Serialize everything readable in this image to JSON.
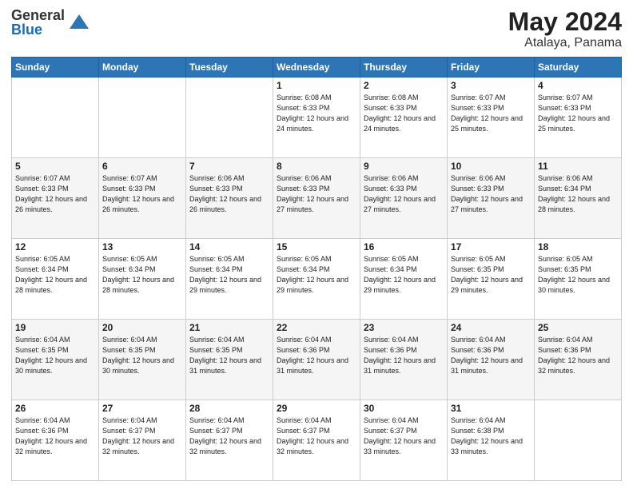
{
  "logo": {
    "general": "General",
    "blue": "Blue"
  },
  "header": {
    "month_year": "May 2024",
    "location": "Atalaya, Panama"
  },
  "weekdays": [
    "Sunday",
    "Monday",
    "Tuesday",
    "Wednesday",
    "Thursday",
    "Friday",
    "Saturday"
  ],
  "weeks": [
    [
      {
        "day": "",
        "sunrise": "",
        "sunset": "",
        "daylight": ""
      },
      {
        "day": "",
        "sunrise": "",
        "sunset": "",
        "daylight": ""
      },
      {
        "day": "",
        "sunrise": "",
        "sunset": "",
        "daylight": ""
      },
      {
        "day": "1",
        "sunrise": "Sunrise: 6:08 AM",
        "sunset": "Sunset: 6:33 PM",
        "daylight": "Daylight: 12 hours and 24 minutes."
      },
      {
        "day": "2",
        "sunrise": "Sunrise: 6:08 AM",
        "sunset": "Sunset: 6:33 PM",
        "daylight": "Daylight: 12 hours and 24 minutes."
      },
      {
        "day": "3",
        "sunrise": "Sunrise: 6:07 AM",
        "sunset": "Sunset: 6:33 PM",
        "daylight": "Daylight: 12 hours and 25 minutes."
      },
      {
        "day": "4",
        "sunrise": "Sunrise: 6:07 AM",
        "sunset": "Sunset: 6:33 PM",
        "daylight": "Daylight: 12 hours and 25 minutes."
      }
    ],
    [
      {
        "day": "5",
        "sunrise": "Sunrise: 6:07 AM",
        "sunset": "Sunset: 6:33 PM",
        "daylight": "Daylight: 12 hours and 26 minutes."
      },
      {
        "day": "6",
        "sunrise": "Sunrise: 6:07 AM",
        "sunset": "Sunset: 6:33 PM",
        "daylight": "Daylight: 12 hours and 26 minutes."
      },
      {
        "day": "7",
        "sunrise": "Sunrise: 6:06 AM",
        "sunset": "Sunset: 6:33 PM",
        "daylight": "Daylight: 12 hours and 26 minutes."
      },
      {
        "day": "8",
        "sunrise": "Sunrise: 6:06 AM",
        "sunset": "Sunset: 6:33 PM",
        "daylight": "Daylight: 12 hours and 27 minutes."
      },
      {
        "day": "9",
        "sunrise": "Sunrise: 6:06 AM",
        "sunset": "Sunset: 6:33 PM",
        "daylight": "Daylight: 12 hours and 27 minutes."
      },
      {
        "day": "10",
        "sunrise": "Sunrise: 6:06 AM",
        "sunset": "Sunset: 6:33 PM",
        "daylight": "Daylight: 12 hours and 27 minutes."
      },
      {
        "day": "11",
        "sunrise": "Sunrise: 6:06 AM",
        "sunset": "Sunset: 6:34 PM",
        "daylight": "Daylight: 12 hours and 28 minutes."
      }
    ],
    [
      {
        "day": "12",
        "sunrise": "Sunrise: 6:05 AM",
        "sunset": "Sunset: 6:34 PM",
        "daylight": "Daylight: 12 hours and 28 minutes."
      },
      {
        "day": "13",
        "sunrise": "Sunrise: 6:05 AM",
        "sunset": "Sunset: 6:34 PM",
        "daylight": "Daylight: 12 hours and 28 minutes."
      },
      {
        "day": "14",
        "sunrise": "Sunrise: 6:05 AM",
        "sunset": "Sunset: 6:34 PM",
        "daylight": "Daylight: 12 hours and 29 minutes."
      },
      {
        "day": "15",
        "sunrise": "Sunrise: 6:05 AM",
        "sunset": "Sunset: 6:34 PM",
        "daylight": "Daylight: 12 hours and 29 minutes."
      },
      {
        "day": "16",
        "sunrise": "Sunrise: 6:05 AM",
        "sunset": "Sunset: 6:34 PM",
        "daylight": "Daylight: 12 hours and 29 minutes."
      },
      {
        "day": "17",
        "sunrise": "Sunrise: 6:05 AM",
        "sunset": "Sunset: 6:35 PM",
        "daylight": "Daylight: 12 hours and 29 minutes."
      },
      {
        "day": "18",
        "sunrise": "Sunrise: 6:05 AM",
        "sunset": "Sunset: 6:35 PM",
        "daylight": "Daylight: 12 hours and 30 minutes."
      }
    ],
    [
      {
        "day": "19",
        "sunrise": "Sunrise: 6:04 AM",
        "sunset": "Sunset: 6:35 PM",
        "daylight": "Daylight: 12 hours and 30 minutes."
      },
      {
        "day": "20",
        "sunrise": "Sunrise: 6:04 AM",
        "sunset": "Sunset: 6:35 PM",
        "daylight": "Daylight: 12 hours and 30 minutes."
      },
      {
        "day": "21",
        "sunrise": "Sunrise: 6:04 AM",
        "sunset": "Sunset: 6:35 PM",
        "daylight": "Daylight: 12 hours and 31 minutes."
      },
      {
        "day": "22",
        "sunrise": "Sunrise: 6:04 AM",
        "sunset": "Sunset: 6:36 PM",
        "daylight": "Daylight: 12 hours and 31 minutes."
      },
      {
        "day": "23",
        "sunrise": "Sunrise: 6:04 AM",
        "sunset": "Sunset: 6:36 PM",
        "daylight": "Daylight: 12 hours and 31 minutes."
      },
      {
        "day": "24",
        "sunrise": "Sunrise: 6:04 AM",
        "sunset": "Sunset: 6:36 PM",
        "daylight": "Daylight: 12 hours and 31 minutes."
      },
      {
        "day": "25",
        "sunrise": "Sunrise: 6:04 AM",
        "sunset": "Sunset: 6:36 PM",
        "daylight": "Daylight: 12 hours and 32 minutes."
      }
    ],
    [
      {
        "day": "26",
        "sunrise": "Sunrise: 6:04 AM",
        "sunset": "Sunset: 6:36 PM",
        "daylight": "Daylight: 12 hours and 32 minutes."
      },
      {
        "day": "27",
        "sunrise": "Sunrise: 6:04 AM",
        "sunset": "Sunset: 6:37 PM",
        "daylight": "Daylight: 12 hours and 32 minutes."
      },
      {
        "day": "28",
        "sunrise": "Sunrise: 6:04 AM",
        "sunset": "Sunset: 6:37 PM",
        "daylight": "Daylight: 12 hours and 32 minutes."
      },
      {
        "day": "29",
        "sunrise": "Sunrise: 6:04 AM",
        "sunset": "Sunset: 6:37 PM",
        "daylight": "Daylight: 12 hours and 32 minutes."
      },
      {
        "day": "30",
        "sunrise": "Sunrise: 6:04 AM",
        "sunset": "Sunset: 6:37 PM",
        "daylight": "Daylight: 12 hours and 33 minutes."
      },
      {
        "day": "31",
        "sunrise": "Sunrise: 6:04 AM",
        "sunset": "Sunset: 6:38 PM",
        "daylight": "Daylight: 12 hours and 33 minutes."
      },
      {
        "day": "",
        "sunrise": "",
        "sunset": "",
        "daylight": ""
      }
    ]
  ]
}
